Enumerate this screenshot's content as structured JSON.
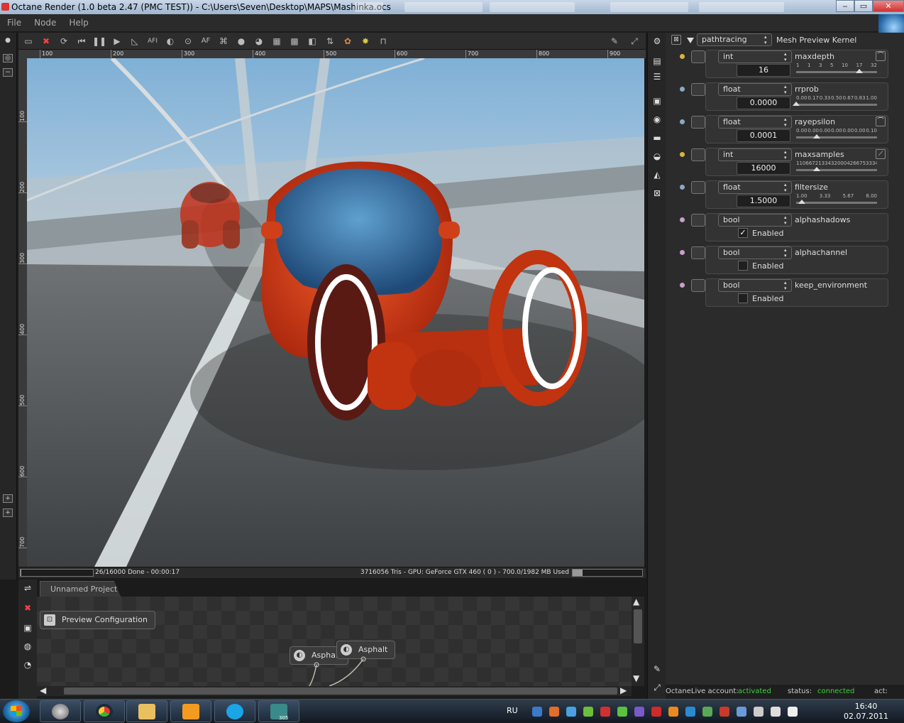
{
  "window": {
    "title": "Octane Render (1.0 beta 2.47 (PMC TEST)) - C:\\Users\\Seven\\Desktop\\MAPS\\Mashinka.ocs",
    "minimize": "‒",
    "maximize": "▭",
    "close": "✕"
  },
  "menu": [
    "File",
    "Node",
    "Help"
  ],
  "toolbar": {
    "icons": [
      "frame-icon",
      "stop-render-icon",
      "restart-icon",
      "rewind-icon",
      "pause-icon",
      "play-icon",
      "pick-focus-icon",
      "autofocus-icon",
      "material-picker-icon",
      "object-picker-icon",
      "af-icon",
      "clay-icon",
      "world-icon",
      "sun-icon",
      "region-icon",
      "checker-icon",
      "alpha-icon",
      "export-icon",
      "color-icon",
      "lock-icon",
      "unlock-icon"
    ],
    "af_label": "AF",
    "afi_label": "AFI"
  },
  "ruler": {
    "h": [
      "100",
      "200",
      "300",
      "400",
      "500",
      "600",
      "700",
      "800",
      "900"
    ],
    "v": [
      "100",
      "200",
      "300",
      "400",
      "500",
      "600",
      "700"
    ]
  },
  "status": {
    "progress": 0.0016,
    "left": "26/16000 Done - 00:00:17",
    "right": "3716056 Tris - GPU: GeForce GTX 460 ( 0 ) - 700.0/1982 MB Used",
    "memory_fraction": 0.353
  },
  "nodegraph": {
    "tab": "Unnamed Project",
    "nodes": [
      {
        "label": "Preview Configuration"
      },
      {
        "label": "Asphalt"
      },
      {
        "label": "Asphalt"
      }
    ]
  },
  "kernel": {
    "type": "pathtracing",
    "name": "Mesh Preview Kernel"
  },
  "params": [
    {
      "type": "int",
      "name": "maxdepth",
      "value": "16",
      "ticks": [
        "1",
        "1",
        "3",
        "5",
        "10",
        "17",
        "32"
      ],
      "pos": 0.78,
      "dot": "#d8b440"
    },
    {
      "type": "float",
      "name": "rrprob",
      "value": "0.0000",
      "ticks": [
        "0.00",
        "0.17",
        "0.33",
        "0.50",
        "0.67",
        "0.83",
        "1.00"
      ],
      "pos": 0.0,
      "dot": "#8fa6c8"
    },
    {
      "type": "float",
      "name": "rayepsilon",
      "value": "0.0001",
      "ticks": [
        "0.00",
        "0.00",
        "0.00",
        "0.00",
        "0.00",
        "0.00",
        "0.10"
      ],
      "pos": 0.25,
      "dot": "#8fa6c8"
    },
    {
      "type": "int",
      "name": "maxsamples",
      "value": "16000",
      "ticks": [
        "1",
        "10667",
        "21334",
        "32000",
        "42667",
        "53334",
        "64000"
      ],
      "pos": 0.25,
      "dot": "#d8b440"
    },
    {
      "type": "float",
      "name": "filtersize",
      "value": "1.5000",
      "ticks": [
        "1.00",
        "3.33",
        "5.67",
        "8.00"
      ],
      "pos": 0.07,
      "dot": "#8fa6c8"
    },
    {
      "type": "bool",
      "name": "alphashadows",
      "checked": true,
      "label": "Enabled",
      "dot": "#c8a0c8"
    },
    {
      "type": "bool",
      "name": "alphachannel",
      "checked": false,
      "label": "Enabled",
      "dot": "#c8a0c8"
    },
    {
      "type": "bool",
      "name": "keep_environment",
      "checked": false,
      "label": "Enabled",
      "dot": "#c8a0c8"
    }
  ],
  "live": {
    "account_label": "OctaneLive account:",
    "account_value": "activated",
    "status_label": "status:",
    "status_value": "connected",
    "act_label": "act:"
  },
  "taskbar": {
    "lang": "RU",
    "time": "16:40",
    "date": "02.07.2011",
    "badge": "305"
  },
  "colors": {
    "accent_green": "#3cd33c",
    "car_red": "#d83a1a"
  }
}
